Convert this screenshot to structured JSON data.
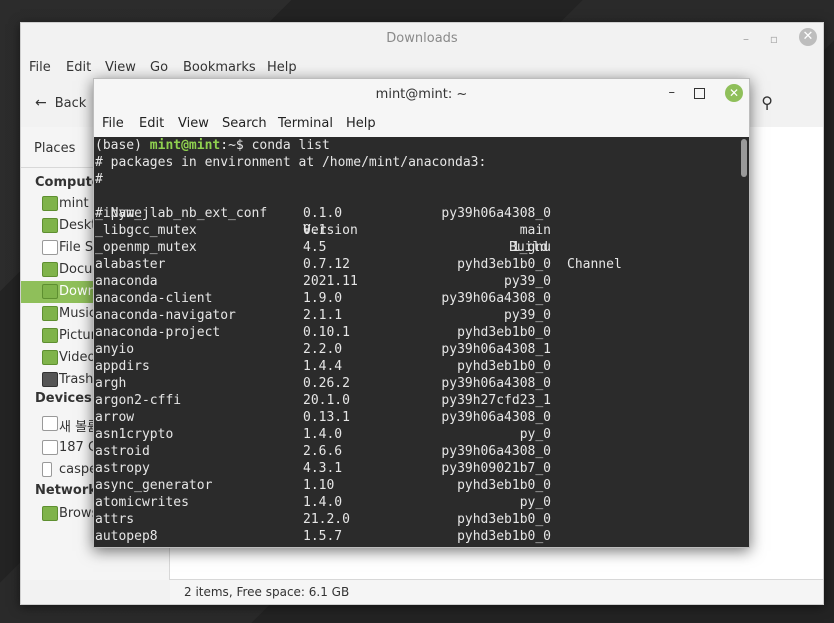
{
  "file_manager": {
    "title": "Downloads",
    "menu": [
      "File",
      "Edit",
      "View",
      "Go",
      "Bookmarks",
      "Help"
    ],
    "back_label": "Back",
    "places_label": "Places",
    "sections": {
      "computer": "Compute",
      "devices": "Devices",
      "network": "Network"
    },
    "computer_items": [
      "mint",
      "Deskt",
      "File Sy",
      "Docu",
      "Down",
      "Music",
      "Pictur",
      "Video",
      "Trash"
    ],
    "device_items": [
      "새 볼륨",
      "187 C",
      "caspe"
    ],
    "network_items": [
      "Brows"
    ],
    "status": "2 items, Free space: 6.1 GB"
  },
  "terminal": {
    "title": "mint@mint: ~",
    "menu": [
      "File",
      "Edit",
      "View",
      "Search",
      "Terminal",
      "Help"
    ],
    "prompt_env": "(base) ",
    "prompt_user": "mint@mint",
    "prompt_path": ":~$ ",
    "command": "conda list",
    "header_line": "# packages in environment at /home/mint/anaconda3:",
    "hash_line": "#",
    "columns": [
      "# Name",
      "Version",
      "Build",
      "Channel"
    ],
    "packages": [
      [
        "_ipyw_jlab_nb_ext_conf",
        "0.1.0",
        "py39h06a4308_0"
      ],
      [
        "_libgcc_mutex",
        "0.1",
        "main"
      ],
      [
        "_openmp_mutex",
        "4.5",
        "1_gnu"
      ],
      [
        "alabaster",
        "0.7.12",
        "pyhd3eb1b0_0"
      ],
      [
        "anaconda",
        "2021.11",
        "py39_0"
      ],
      [
        "anaconda-client",
        "1.9.0",
        "py39h06a4308_0"
      ],
      [
        "anaconda-navigator",
        "2.1.1",
        "py39_0"
      ],
      [
        "anaconda-project",
        "0.10.1",
        "pyhd3eb1b0_0"
      ],
      [
        "anyio",
        "2.2.0",
        "py39h06a4308_1"
      ],
      [
        "appdirs",
        "1.4.4",
        "pyhd3eb1b0_0"
      ],
      [
        "argh",
        "0.26.2",
        "py39h06a4308_0"
      ],
      [
        "argon2-cffi",
        "20.1.0",
        "py39h27cfd23_1"
      ],
      [
        "arrow",
        "0.13.1",
        "py39h06a4308_0"
      ],
      [
        "asn1crypto",
        "1.4.0",
        "py_0"
      ],
      [
        "astroid",
        "2.6.6",
        "py39h06a4308_0"
      ],
      [
        "astropy",
        "4.3.1",
        "py39h09021b7_0"
      ],
      [
        "async_generator",
        "1.10",
        "pyhd3eb1b0_0"
      ],
      [
        "atomicwrites",
        "1.4.0",
        "py_0"
      ],
      [
        "attrs",
        "21.2.0",
        "pyhd3eb1b0_0"
      ],
      [
        "autopep8",
        "1.5.7",
        "pyhd3eb1b0_0"
      ]
    ]
  }
}
